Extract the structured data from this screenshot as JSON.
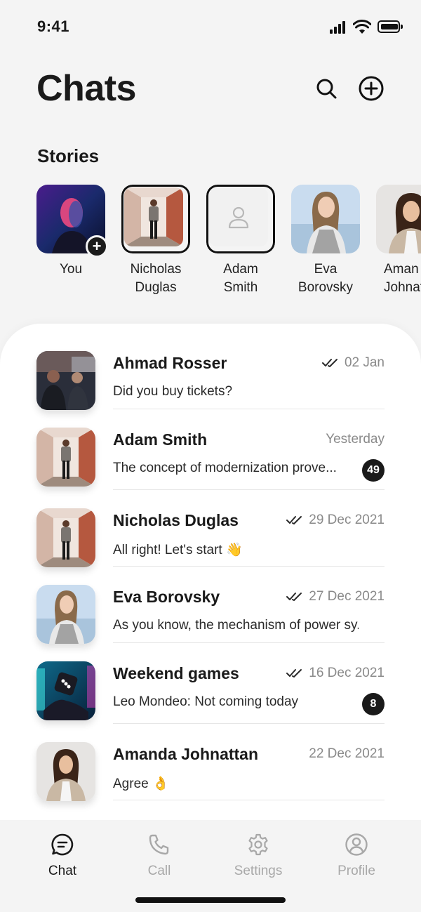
{
  "status_bar": {
    "time": "9:41"
  },
  "header": {
    "title": "Chats",
    "search_icon": "search-icon",
    "new_chat_icon": "plus-circle-icon"
  },
  "stories": {
    "title": "Stories",
    "items": [
      {
        "name": "You",
        "photo": "portrait-neon-man",
        "has_add_badge": true
      },
      {
        "name": "Nicholas\nDuglas",
        "photo": "man-in-hallway",
        "ring": true
      },
      {
        "name": "Adam\nSmith",
        "photo": "user-placeholder-icon",
        "ring": true
      },
      {
        "name": "Eva\nBorovsky",
        "photo": "woman-beach"
      },
      {
        "name": "Aman\nJohnat",
        "photo": "woman-curly-hair"
      }
    ]
  },
  "chats": [
    {
      "name": "Ahmad Rosser",
      "date": "02 Jan",
      "read": true,
      "preview": "Did you buy tickets?",
      "unread": null,
      "photo": "two-men-in-car"
    },
    {
      "name": "Adam Smith",
      "date": "Yesterday",
      "read": false,
      "preview": "The concept of modernization prove...",
      "unread": "49",
      "photo": "man-in-hallway"
    },
    {
      "name": "Nicholas Duglas",
      "date": "29 Dec 2021",
      "read": true,
      "preview": "All right! Let's start 👋",
      "unread": null,
      "photo": "man-in-hallway"
    },
    {
      "name": "Eva Borovsky",
      "date": "27 Dec 2021",
      "read": true,
      "preview": "As you know, the mechanism of power sy...",
      "unread": null,
      "photo": "woman-beach"
    },
    {
      "name": "Weekend games",
      "date": "16 Dec 2021",
      "read": true,
      "preview": "Leo Mondeo: Not coming today",
      "unread": "8",
      "photo": "neon-dice"
    },
    {
      "name": "Amanda Johnattan",
      "date": "22 Dec 2021",
      "read": false,
      "preview": "Agree 👌",
      "unread": null,
      "photo": "woman-curly-hair"
    }
  ],
  "nav": {
    "items": [
      {
        "label": "Chat",
        "icon": "chat-bubble-icon",
        "active": true
      },
      {
        "label": "Call",
        "icon": "phone-icon",
        "active": false
      },
      {
        "label": "Settings",
        "icon": "gear-icon",
        "active": false
      },
      {
        "label": "Profile",
        "icon": "user-circle-icon",
        "active": false
      }
    ]
  },
  "colors": {
    "background": "#f4f4f4",
    "card": "#ffffff",
    "text": "#1a1a1a",
    "muted": "#8a8a8a",
    "badge": "#1a1a1a"
  }
}
